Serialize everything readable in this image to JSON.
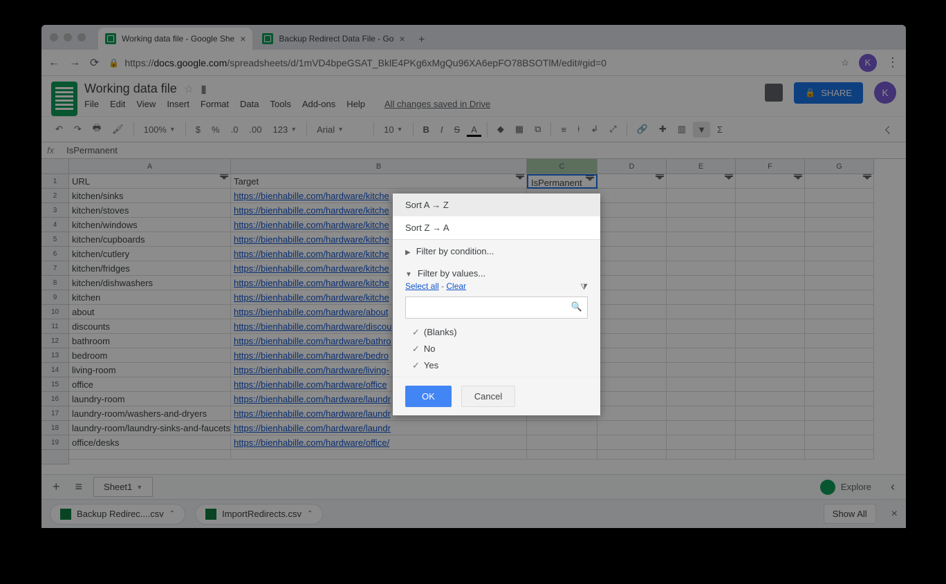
{
  "tabs": [
    {
      "title": "Working data file - Google She"
    },
    {
      "title": "Backup Redirect Data File - Go"
    }
  ],
  "url": {
    "scheme": "https://",
    "host": "docs.google.com",
    "path": "/spreadsheets/d/1mVD4bpeGSAT_BklE4PKg6xMgQu96XA6epFO78BSOTlM/edit#gid=0"
  },
  "avatar": "K",
  "doc": {
    "title": "Working data file",
    "saved": "All changes saved in Drive"
  },
  "menus": [
    "File",
    "Edit",
    "View",
    "Insert",
    "Format",
    "Data",
    "Tools",
    "Add-ons",
    "Help"
  ],
  "share": "SHARE",
  "toolbar": {
    "zoom": "100%",
    "font": "Arial",
    "size": "10",
    "fmt": "123"
  },
  "fx": "IsPermanent",
  "cols": [
    "A",
    "B",
    "C",
    "D",
    "E",
    "F",
    "G"
  ],
  "headers": [
    "URL",
    "Target",
    "IsPermanent"
  ],
  "rows": [
    {
      "n": "2",
      "a": "kitchen/sinks",
      "b": "https://bienhabille.com/hardware/kitche"
    },
    {
      "n": "3",
      "a": "kitchen/stoves",
      "b": "https://bienhabille.com/hardware/kitche"
    },
    {
      "n": "4",
      "a": "kitchen/windows",
      "b": "https://bienhabille.com/hardware/kitche"
    },
    {
      "n": "5",
      "a": "kitchen/cupboards",
      "b": "https://bienhabille.com/hardware/kitche"
    },
    {
      "n": "6",
      "a": "kitchen/cutlery",
      "b": "https://bienhabille.com/hardware/kitche"
    },
    {
      "n": "7",
      "a": "kitchen/fridges",
      "b": "https://bienhabille.com/hardware/kitche"
    },
    {
      "n": "8",
      "a": "kitchen/dishwashers",
      "b": "https://bienhabille.com/hardware/kitche"
    },
    {
      "n": "9",
      "a": "kitchen",
      "b": "https://bienhabille.com/hardware/kitche"
    },
    {
      "n": "10",
      "a": "about",
      "b": "https://bienhabille.com/hardware/about"
    },
    {
      "n": "11",
      "a": "discounts",
      "b": "https://bienhabille.com/hardware/discou"
    },
    {
      "n": "12",
      "a": "bathroom",
      "b": "https://bienhabille.com/hardware/bathro"
    },
    {
      "n": "13",
      "a": "bedroom",
      "b": "https://bienhabille.com/hardware/bedro"
    },
    {
      "n": "14",
      "a": "living-room",
      "b": "https://bienhabille.com/hardware/living-"
    },
    {
      "n": "15",
      "a": "office",
      "b": "https://bienhabille.com/hardware/office"
    },
    {
      "n": "16",
      "a": "laundry-room",
      "b": "https://bienhabille.com/hardware/laundr"
    },
    {
      "n": "17",
      "a": "laundry-room/washers-and-dryers",
      "b": "https://bienhabille.com/hardware/laundr"
    },
    {
      "n": "18",
      "a": "laundry-room/laundry-sinks-and-faucets",
      "b": "https://bienhabille.com/hardware/laundr"
    },
    {
      "n": "19",
      "a": "office/desks",
      "b": "https://bienhabille.com/hardware/office/"
    }
  ],
  "dropdown": {
    "sortAZ": "Sort A → Z",
    "sortZA": "Sort Z → A",
    "cond": "Filter by condition...",
    "vals": "Filter by values...",
    "selectall": "Select all",
    "clear": "Clear",
    "opts": [
      "(Blanks)",
      "No",
      "Yes"
    ],
    "ok": "OK",
    "cancel": "Cancel"
  },
  "sheet": "Sheet1",
  "explore": "Explore",
  "downloads": [
    {
      "name": "Backup Redirec....csv"
    },
    {
      "name": "ImportRedirects.csv"
    }
  ],
  "showall": "Show All"
}
